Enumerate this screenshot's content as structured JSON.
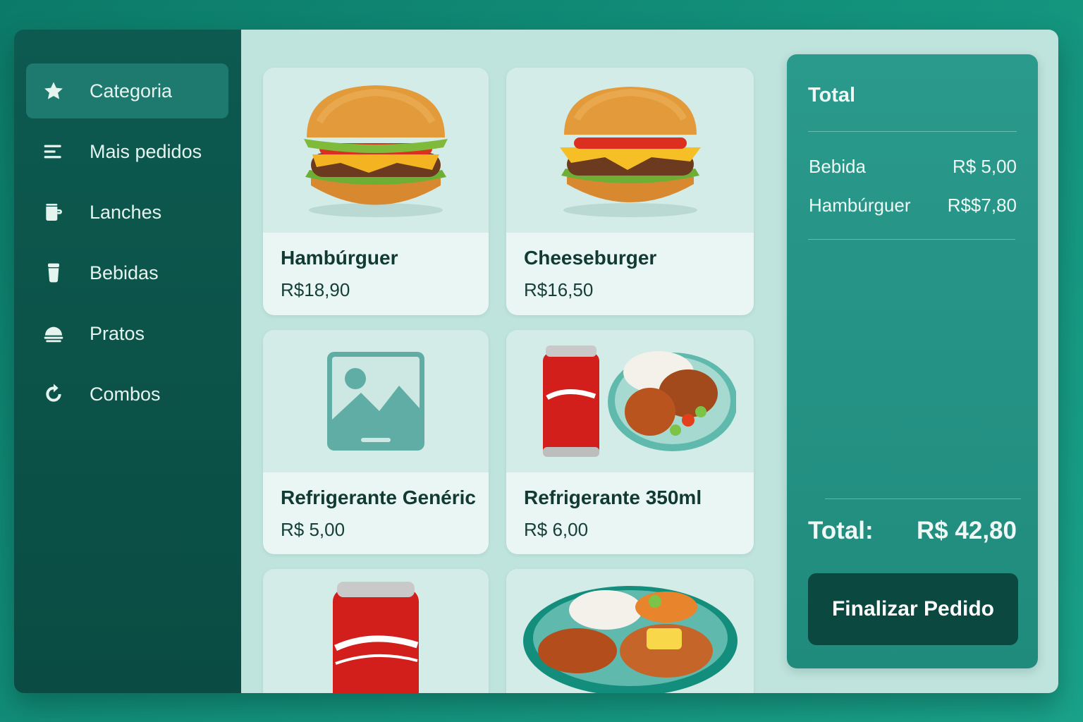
{
  "sidebar": {
    "items": [
      {
        "label": "Categoria",
        "icon": "star-icon",
        "active": true
      },
      {
        "label": "Mais pedidos",
        "icon": "list-icon"
      },
      {
        "label": "Lanches",
        "icon": "mug-icon"
      },
      {
        "label": "Bebidas",
        "icon": "cup-icon"
      },
      {
        "label": "Pratos",
        "icon": "cloche-icon"
      },
      {
        "label": "Combos",
        "icon": "refresh-icon"
      }
    ]
  },
  "products": [
    {
      "name": "Hambúrguer",
      "price": "R$18,90",
      "image": "burger-image"
    },
    {
      "name": "Cheeseburger",
      "price": "R$16,50",
      "image": "cheeseburger-image"
    },
    {
      "name": "Refrigerante Genéric",
      "price": "R$ 5,00",
      "image": "image-placeholder-icon"
    },
    {
      "name": "Refrigerante 350ml",
      "price": "R$ 6,00",
      "image": "soda-combo-image"
    },
    {
      "name": "",
      "price": "",
      "image": "soda-can-image"
    },
    {
      "name": "",
      "price": "",
      "image": "plate-meal-image"
    }
  ],
  "order": {
    "title": "Total",
    "items": [
      {
        "label": "Bebida",
        "amount": "R$ 5,00"
      },
      {
        "label": "Hambúrguer",
        "amount": "R$$7,80"
      }
    ],
    "total_label": "Total:",
    "total_value": "R$ 42,80",
    "checkout_label": "Finalizar Pedido"
  },
  "colors": {
    "background": "#12907a",
    "sidebar": "#0d5a50",
    "sidebar_active": "#1e7a6e",
    "main": "#bfe3dd",
    "card": "#e9f6f3",
    "panel": "#2a9a8c",
    "checkout_button": "#0a4840"
  }
}
